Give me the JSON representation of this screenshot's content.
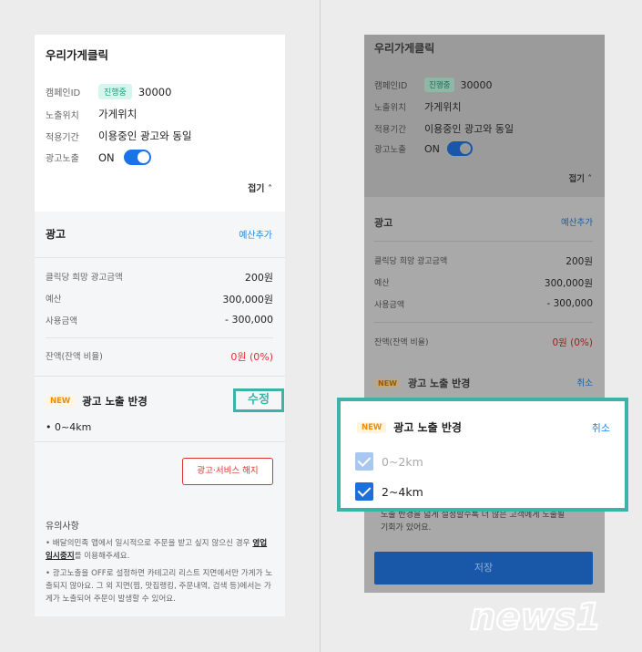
{
  "left": {
    "title": "우리가게클릭",
    "campaign_key": "캠페인ID",
    "campaign_badge": "진행중",
    "campaign_id": "30000",
    "exposure_key": "노출위치",
    "exposure_val": "가게위치",
    "period_key": "적용기간",
    "period_val": "이용중인 광고와 동일",
    "ad_exposure_key": "광고노출",
    "ad_exposure_val": "ON",
    "fold_label": "접기 ˄",
    "ad_section_title": "광고",
    "add_budget": "예산추가",
    "rows": [
      {
        "k": "클릭당 희망 광고금액",
        "v": "200원"
      },
      {
        "k": "예산",
        "v": "300,000원"
      },
      {
        "k": "사용금액",
        "v": "- 300,000"
      }
    ],
    "balance_key": "잔액(잔액 비율)",
    "balance_val": "0원 (0%)",
    "new_badge": "NEW",
    "radius_title": "광고 노출 반경",
    "edit_label": "수정",
    "radius_value": "•  0~4km",
    "cancel_service": "광고·서비스 해지",
    "notice_title": "유의사항",
    "notice_1_a": "•  배달의민족 앱에서 일시적으로 주문을 받고 싶지 않으신 경우 ",
    "notice_1_b": "영업임시중지",
    "notice_1_c": "를 이용해주세요.",
    "notice_2": "•  광고노출을 OFF로 설정하면 카테고리 리스트 지면에서만 가게가 노출되지 않아요. 그 외 지면(찜, 맛집랭킹, 주문내역, 검색 등)에서는 가게가 노출되어 주문이 발생할 수 있어요."
  },
  "right": {
    "title": "우리가게클릭",
    "campaign_key": "캠페인ID",
    "campaign_badge": "진행중",
    "campaign_id": "30000",
    "exposure_key": "노출위치",
    "exposure_val": "가게위치",
    "period_key": "적용기간",
    "period_val": "이용중인 광고와 동일",
    "ad_exposure_key": "광고노출",
    "ad_exposure_val": "ON",
    "fold_label": "접기 ˄",
    "ad_section_title": "광고",
    "add_budget": "예산추가",
    "rows": [
      {
        "k": "클릭당 희망 광고금액",
        "v": "200원"
      },
      {
        "k": "예산",
        "v": "300,000원"
      },
      {
        "k": "사용금액",
        "v": "- 300,000"
      }
    ],
    "balance_key": "잔액(잔액 비율)",
    "balance_val": "0원 (0%)",
    "new_badge": "NEW",
    "radius_title": "광고 노출 반경",
    "cancel_label": "취소",
    "hidden_text_1": "노출 반경을 넓게 설정할수록 더 많은 고객에게 노출될",
    "hidden_text_2": "기회가 있어요.",
    "save_label": "저장"
  },
  "popup": {
    "new_badge": "NEW",
    "title": "광고 노출 반경",
    "cancel_label": "취소",
    "options": [
      {
        "label": "0~2km",
        "checked": true,
        "disabled": true
      },
      {
        "label": "2~4km",
        "checked": true,
        "disabled": false
      }
    ]
  },
  "watermark": {
    "text": "news1"
  },
  "colors": {
    "accent": "#3bb3a8",
    "blue": "#1e88e5",
    "red": "#e03131",
    "badge_green": "#17a27a"
  }
}
